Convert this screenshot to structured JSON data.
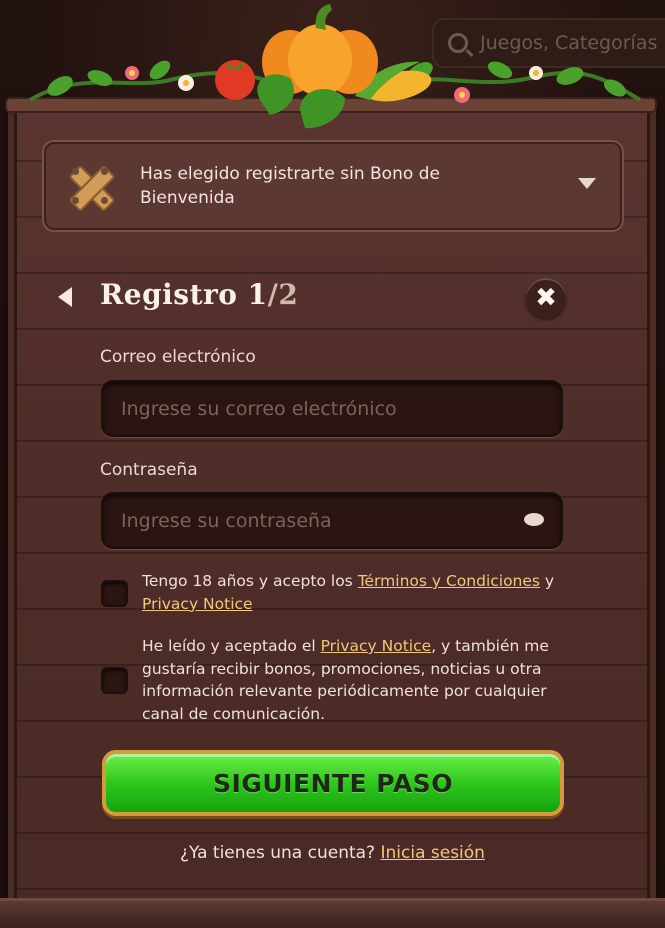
{
  "background": {
    "search_placeholder": "Juegos, Categorías"
  },
  "bonus": {
    "text_line1": "Has elegido registrarte sin Bono de",
    "text_line2": "Bienvenida"
  },
  "header": {
    "title_main": "Registro 1",
    "title_frac": "/2"
  },
  "form": {
    "email_label": "Correo electrónico",
    "email_placeholder": "Ingrese su correo electrónico",
    "email_value": "",
    "password_label": "Contraseña",
    "password_placeholder": "Ingrese su contraseña",
    "password_value": ""
  },
  "checkbox1": {
    "text_a": "Tengo 18 años y acepto los ",
    "link_terms": "Términos y Condiciones",
    "text_b": " y",
    "link_privacy": "Privacy Notice"
  },
  "checkbox2": {
    "text_a": "He leído y aceptado el ",
    "link_privacy": "Privacy Notice",
    "text_b": ", y también me gustaría recibir bonos, promociones, noticias u otra información relevante periódicamente por cualquier canal de comunicación."
  },
  "next_button": "SIGUIENTE PASO",
  "footer": {
    "question": "¿Ya tienes una cuenta? ",
    "login_link": "Inicia sesión"
  },
  "colors": {
    "accent_green": "#2fc71d",
    "link": "#f2c77e",
    "panel": "#4f2d28"
  },
  "icons": [
    "search-icon",
    "crossed-planks-icon",
    "chevron-down-icon",
    "back-arrow-icon",
    "close-icon",
    "eye-icon",
    "pumpkin-icon",
    "tomato-icon",
    "corn-icon",
    "flower-icon",
    "leaf-icon"
  ]
}
